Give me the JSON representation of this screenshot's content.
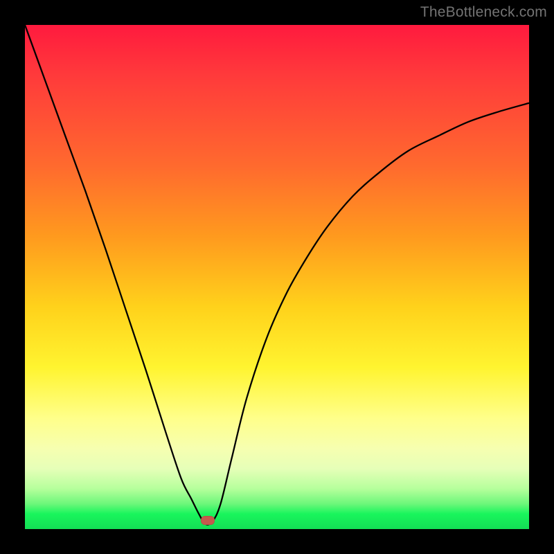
{
  "watermark": "TheBottleneck.com",
  "marker": {
    "x_frac": 0.363,
    "y_frac": 0.982
  },
  "chart_data": {
    "type": "line",
    "title": "",
    "xlabel": "",
    "ylabel": "",
    "xlim": [
      0,
      1
    ],
    "ylim": [
      0,
      1
    ],
    "grid": false,
    "legend": false,
    "annotations": [
      "TheBottleneck.com"
    ],
    "series": [
      {
        "name": "curve",
        "color": "#000000",
        "x": [
          0.0,
          0.04,
          0.08,
          0.12,
          0.16,
          0.2,
          0.24,
          0.28,
          0.31,
          0.33,
          0.345,
          0.358,
          0.372,
          0.388,
          0.41,
          0.44,
          0.48,
          0.52,
          0.56,
          0.6,
          0.65,
          0.7,
          0.76,
          0.82,
          0.88,
          0.94,
          1.0
        ],
        "y": [
          1.0,
          0.89,
          0.78,
          0.67,
          0.555,
          0.435,
          0.315,
          0.19,
          0.1,
          0.06,
          0.03,
          0.01,
          0.015,
          0.05,
          0.14,
          0.26,
          0.38,
          0.47,
          0.54,
          0.6,
          0.66,
          0.705,
          0.75,
          0.78,
          0.808,
          0.828,
          0.845
        ]
      }
    ],
    "marker_point": {
      "x": 0.363,
      "y": 0.018,
      "color": "#c55a4d"
    },
    "background_gradient": {
      "orientation": "vertical",
      "stops": [
        {
          "pos": 0.0,
          "color": "#ff1a3e"
        },
        {
          "pos": 0.28,
          "color": "#ff6a2e"
        },
        {
          "pos": 0.56,
          "color": "#ffd21b"
        },
        {
          "pos": 0.78,
          "color": "#ffff8a"
        },
        {
          "pos": 0.95,
          "color": "#6cf77a"
        },
        {
          "pos": 1.0,
          "color": "#13df55"
        }
      ]
    }
  }
}
